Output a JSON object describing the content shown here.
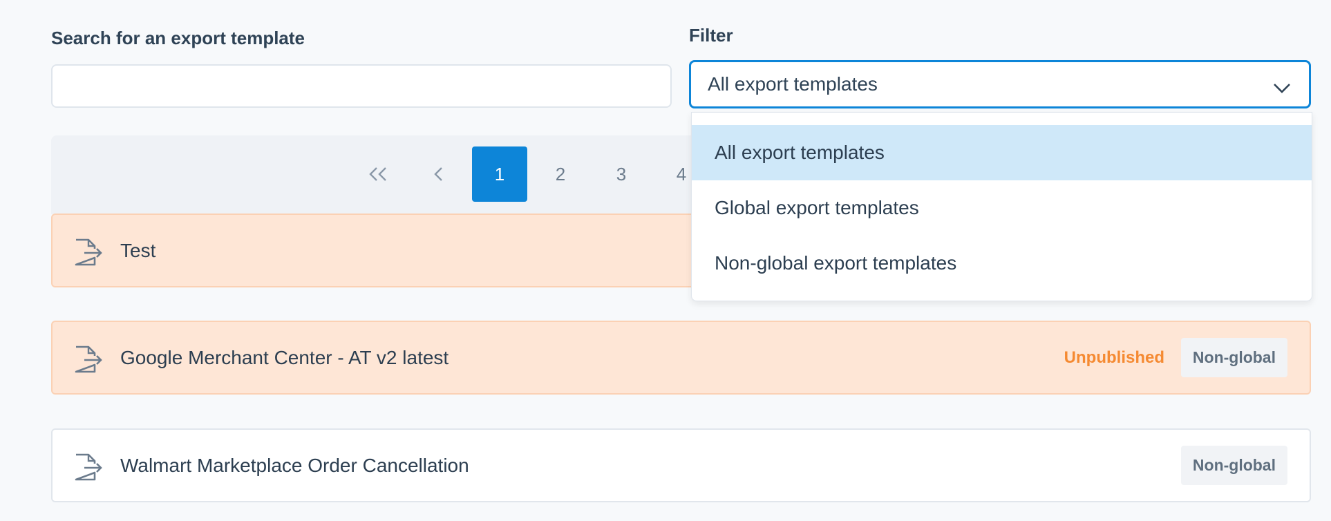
{
  "search": {
    "label": "Search for an export template",
    "value": "",
    "placeholder": ""
  },
  "filter": {
    "label": "Filter",
    "selected": "All export templates",
    "options": [
      "All export templates",
      "Global export templates",
      "Non-global export templates"
    ],
    "accent_color": "#0d85d8"
  },
  "pagination": {
    "first_icon": "double-chevron-left-icon",
    "prev_icon": "chevron-left-icon",
    "pages": [
      "1",
      "2",
      "3",
      "4"
    ],
    "current": "1"
  },
  "templates": [
    {
      "name": "Test",
      "icon": "file-export-icon",
      "highlight": true
    },
    {
      "name": "Google Merchant Center - AT v2 latest",
      "icon": "file-export-icon",
      "highlight": true,
      "status": "Unpublished",
      "scope": "Non-global"
    },
    {
      "name": "Walmart Marketplace Order Cancellation",
      "icon": "file-export-icon",
      "highlight": false,
      "scope": "Non-global"
    }
  ],
  "colors": {
    "warning_bg": "#fee6d6",
    "unpublished": "#f58a32"
  }
}
